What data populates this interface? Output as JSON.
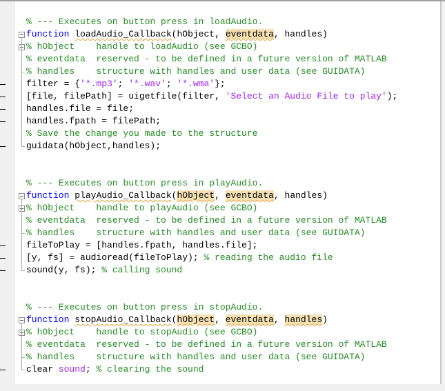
{
  "editor": {
    "blocks": [
      {
        "name": "loadAudio",
        "lines": [
          {
            "segments": [
              {
                "t": "% --- Executes on button press in loadAudio.",
                "c": "cm"
              }
            ]
          },
          {
            "segments": [
              {
                "t": "function",
                "c": "kw"
              },
              {
                "t": " "
              },
              {
                "t": "loadAudio_Callback",
                "c": "fn"
              },
              {
                "t": "(hObject, "
              },
              {
                "t": "eventdata",
                "c": "hl"
              },
              {
                "t": ", handles)"
              }
            ]
          },
          {
            "segments": [
              {
                "t": "% hObject    handle to loadAudio (see GCBO)",
                "c": "cm"
              }
            ]
          },
          {
            "segments": [
              {
                "t": "% eventdata  reserved - to be defined in a future version of MATLAB",
                "c": "cm"
              }
            ]
          },
          {
            "segments": [
              {
                "t": "% handles    structure with handles and user data (see GUIDATA)",
                "c": "cm"
              }
            ]
          },
          {
            "segments": [
              {
                "t": "filter = {"
              },
              {
                "t": "'*.mp3'",
                "c": "str"
              },
              {
                "t": "; "
              },
              {
                "t": "'*.wav'",
                "c": "str"
              },
              {
                "t": "; "
              },
              {
                "t": "'*.wma'",
                "c": "str"
              },
              {
                "t": "};"
              }
            ]
          },
          {
            "segments": [
              {
                "t": "[file, filePath] = uigetfile(filter, "
              },
              {
                "t": "'Select an Audio File to play'",
                "c": "str"
              },
              {
                "t": ");"
              }
            ]
          },
          {
            "segments": [
              {
                "t": "handles.file = file;"
              }
            ]
          },
          {
            "segments": [
              {
                "t": "handles.fpath = filePath;"
              }
            ]
          },
          {
            "segments": [
              {
                "t": "% Save the change you made to the structure",
                "c": "cm"
              }
            ]
          },
          {
            "segments": [
              {
                "t": "guidata(hObject,handles);"
              }
            ]
          }
        ]
      },
      {
        "name": "playAudio",
        "lines": [
          {
            "segments": [
              {
                "t": "% --- Executes on button press in playAudio.",
                "c": "cm"
              }
            ]
          },
          {
            "segments": [
              {
                "t": "function",
                "c": "kw"
              },
              {
                "t": " "
              },
              {
                "t": "playAudio_Callback",
                "c": "fn"
              },
              {
                "t": "("
              },
              {
                "t": "hObject",
                "c": "hl"
              },
              {
                "t": ", "
              },
              {
                "t": "eventdata",
                "c": "hl"
              },
              {
                "t": ", handles)"
              }
            ]
          },
          {
            "segments": [
              {
                "t": "% hObject    handle to playAudio (see GCBO)",
                "c": "cm"
              }
            ]
          },
          {
            "segments": [
              {
                "t": "% eventdata  reserved - to be defined in a future version of MATLAB",
                "c": "cm"
              }
            ]
          },
          {
            "segments": [
              {
                "t": "% handles    structure with handles and user data (see GUIDATA)",
                "c": "cm"
              }
            ]
          },
          {
            "segments": [
              {
                "t": "fileToPlay = [handles.fpath, handles.file];"
              }
            ]
          },
          {
            "segments": [
              {
                "t": "[y, fs] = audioread(fileToPlay); "
              },
              {
                "t": "% reading the audio file",
                "c": "cm"
              }
            ]
          },
          {
            "segments": [
              {
                "t": "sound(y, fs); "
              },
              {
                "t": "% calling sound",
                "c": "cm"
              }
            ]
          }
        ]
      },
      {
        "name": "stopAudio",
        "lines": [
          {
            "segments": [
              {
                "t": "% --- Executes on button press in stopAudio.",
                "c": "cm"
              }
            ]
          },
          {
            "segments": [
              {
                "t": "function",
                "c": "kw"
              },
              {
                "t": " "
              },
              {
                "t": "stopAudio_Callback",
                "c": "fn"
              },
              {
                "t": "("
              },
              {
                "t": "hObject",
                "c": "hl"
              },
              {
                "t": ", "
              },
              {
                "t": "eventdata",
                "c": "hl"
              },
              {
                "t": ", "
              },
              {
                "t": "handles",
                "c": "hl"
              },
              {
                "t": ")"
              }
            ]
          },
          {
            "segments": [
              {
                "t": "% hObject    handle to stopAudio (see GCBO)",
                "c": "cm"
              }
            ]
          },
          {
            "segments": [
              {
                "t": "% eventdata  reserved - to be defined in a future version of MATLAB",
                "c": "cm"
              }
            ]
          },
          {
            "segments": [
              {
                "t": "% handles    structure with handles and user data (see GUIDATA)",
                "c": "cm"
              }
            ]
          },
          {
            "segments": [
              {
                "t": "clear "
              },
              {
                "t": "sound",
                "c": "str"
              },
              {
                "t": "; "
              },
              {
                "t": "% clearing the sound",
                "c": "cm"
              }
            ]
          }
        ]
      }
    ]
  },
  "colors": {
    "keyword": "#0000ff",
    "comment": "#228b22",
    "string": "#a020f0",
    "highlight": "#f5e1b3"
  }
}
